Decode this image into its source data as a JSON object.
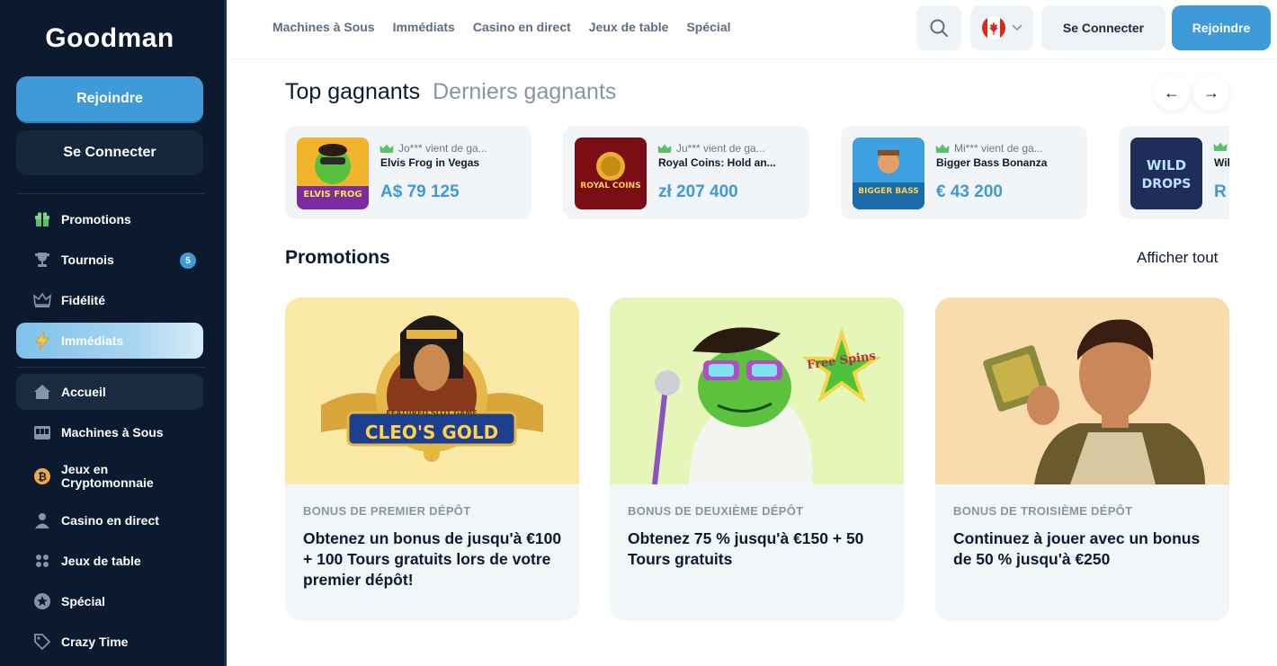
{
  "brand": {
    "logo": "Goodman"
  },
  "sidebar": {
    "join_label": "Rejoindre",
    "login_label": "Se Connecter",
    "items": [
      {
        "label": "Promotions",
        "icon": "gift-icon"
      },
      {
        "label": "Tournois",
        "icon": "trophy-icon",
        "badge": "5"
      },
      {
        "label": "Fidélité",
        "icon": "crown-icon"
      },
      {
        "label": "Immédiats",
        "icon": "lightning-icon"
      },
      {
        "label": "Accueil",
        "icon": "home-icon"
      },
      {
        "label": "Machines à Sous",
        "icon": "slot-machine-icon"
      },
      {
        "label": "Jeux en Cryptomonnaie",
        "icon": "bitcoin-icon"
      },
      {
        "label": "Casino en direct",
        "icon": "dealer-icon"
      },
      {
        "label": "Jeux de table",
        "icon": "cards-icon"
      },
      {
        "label": "Spécial",
        "icon": "star-icon"
      },
      {
        "label": "Crazy Time",
        "icon": "tag-icon"
      }
    ]
  },
  "topbar": {
    "nav": [
      "Machines à Sous",
      "Immédiats",
      "Casino en direct",
      "Jeux de table",
      "Spécial"
    ],
    "login_label": "Se Connecter",
    "join_label": "Rejoindre",
    "language_flag": "canada-flag-icon"
  },
  "winners": {
    "tab_active": "Top gagnants",
    "tab_inactive": "Derniers gagnants",
    "cards": [
      {
        "user": "Jo*** vient de ga...",
        "game": "Elvis Frog in Vegas",
        "amount": "A$ 79 125",
        "thumb_text": "ELVIS FROG"
      },
      {
        "user": "Ju*** vient de ga...",
        "game": "Royal Coins: Hold an...",
        "amount": "zł 207 400",
        "thumb_text": "ROYAL COINS"
      },
      {
        "user": "Mi*** vient de ga...",
        "game": "Bigger Bass Bonanza",
        "amount": "€ 43 200",
        "thumb_text": "BIGGER BASS"
      },
      {
        "user": "",
        "game": "Wil",
        "amount": "R",
        "thumb_text": "WILD DROPS"
      }
    ]
  },
  "promotions": {
    "title": "Promotions",
    "see_all": "Afficher tout",
    "cards": [
      {
        "category": "BONUS DE PREMIER DÉPÔT",
        "text": "Obtenez un bonus de jusqu'à €100 + 100 Tours gratuits lors de votre premier dépôt!",
        "banner": "CLEO'S GOLD",
        "banner_sub": "FEATURED SLOT GAME",
        "bg": "#fbe9a8"
      },
      {
        "category": "BONUS DE DEUXIÈME DÉPÔT",
        "text": "Obtenez 75 % jusqu'à €150 + 50 Tours gratuits",
        "banner": "Free Spins",
        "bg": "#e6f6b8"
      },
      {
        "category": "BONUS DE TROISIÈME DÉPÔT",
        "text": "Continuez à jouer avec un bonus de 50 % jusqu'à €250",
        "bg": "#f8dcae"
      }
    ]
  },
  "colors": {
    "accent": "#3f9ad8",
    "sidebar_bg": "#0b1a2e",
    "win_amount": "#3f9ad8"
  }
}
